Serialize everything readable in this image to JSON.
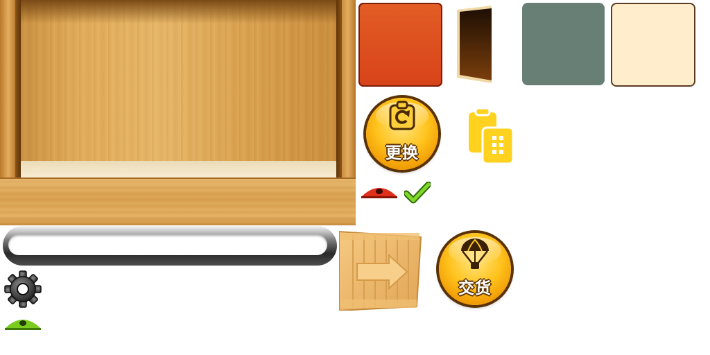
{
  "buttons": {
    "change_label": "更换",
    "deliver_label": "交货"
  },
  "progress": {
    "value": 0.0
  },
  "icons": {
    "change": "rotate-icon",
    "deliver": "parachute-icon",
    "clipboard": "clipboard-icon",
    "settings": "gear-icon",
    "visibility_red": "eye-icon",
    "visibility_green": "eye-icon",
    "confirm": "checkmark-icon",
    "crate": "crate-arrow-icon"
  },
  "colors": {
    "swatch_orange": "#dc4e1f",
    "swatch_gray": "#677f75",
    "swatch_cream": "#ffedcc",
    "gold": "#ffc31d",
    "eye_red": "#e0301c",
    "eye_green": "#7ccc1f",
    "check_green": "#6cc21c"
  }
}
